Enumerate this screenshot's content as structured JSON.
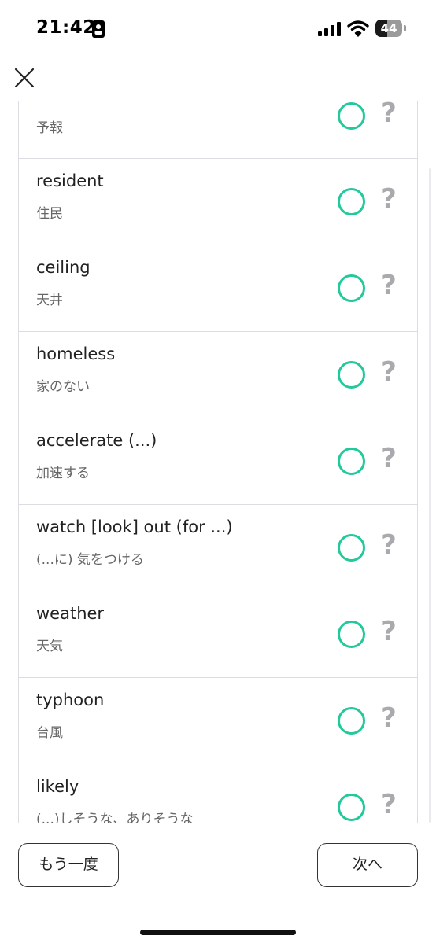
{
  "status_bar": {
    "time": "21:42",
    "battery_level": "44",
    "battery_fraction": 0.44
  },
  "header": {
    "close_icon": "close-x-icon"
  },
  "word_list": [
    {
      "en": "forecast",
      "ja": "予報"
    },
    {
      "en": "resident",
      "ja": "住民"
    },
    {
      "en": "ceiling",
      "ja": "天井"
    },
    {
      "en": "homeless",
      "ja": "家のない"
    },
    {
      "en": "accelerate (...)",
      "ja": "加速する"
    },
    {
      "en": "watch [look] out (for ...)",
      "ja": "(...に) 気をつける"
    },
    {
      "en": "weather",
      "ja": "天気"
    },
    {
      "en": "typhoon",
      "ja": "台風"
    },
    {
      "en": "likely",
      "ja": "(...)しそうな、ありそうな"
    }
  ],
  "item_actions": {
    "known_icon": "circle-icon",
    "unknown_label": "?"
  },
  "footer": {
    "retry_label": "もう一度",
    "next_label": "次へ"
  },
  "colors": {
    "accent": "#22c99a",
    "unknown": "#a9a9ae",
    "border": "#dcdce2"
  }
}
